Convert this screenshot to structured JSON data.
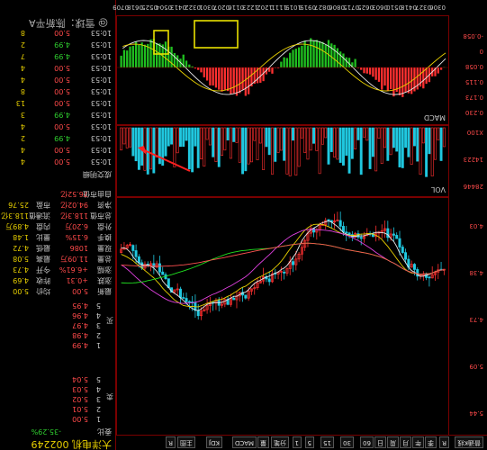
{
  "quote": {
    "title": "大洋电机 002249",
    "change_label": "委比",
    "change_value": "-35.29%",
    "sell_label": "卖",
    "buy_label": "买",
    "sell_levels": [
      {
        "n": "5",
        "price": "5.04",
        "vol": ""
      },
      {
        "n": "4",
        "price": "5.03",
        "vol": ""
      },
      {
        "n": "3",
        "price": "5.02",
        "vol": ""
      },
      {
        "n": "2",
        "price": "5.01",
        "vol": ""
      },
      {
        "n": "1",
        "price": "5.00",
        "vol": ""
      }
    ],
    "buy_levels": [
      {
        "n": "1",
        "price": "4.99",
        "vol": ""
      },
      {
        "n": "2",
        "price": "4.98",
        "vol": ""
      },
      {
        "n": "3",
        "price": "4.97",
        "vol": ""
      },
      {
        "n": "4",
        "price": "4.96",
        "vol": ""
      },
      {
        "n": "5",
        "price": "4.95",
        "vol": ""
      }
    ],
    "stats": [
      {
        "l1": "最新",
        "v1": "5.00",
        "l2": "均价",
        "v2": "5.00"
      },
      {
        "l1": "涨跌",
        "v1": "+0.31",
        "l2": "昨收",
        "v2": "4.69"
      },
      {
        "l1": "涨幅",
        "v1": "+6.61%",
        "l2": "今开",
        "v2": "4.73"
      },
      {
        "l1": "总量",
        "v1": "11.09万",
        "l2": "最高",
        "v2": "5.08"
      },
      {
        "l1": "现量",
        "v1": "1086",
        "l2": "最低",
        "v2": "4.72"
      },
      {
        "l1": "换手",
        "v1": "6.15%",
        "l2": "量比",
        "v2": "1.48"
      },
      {
        "l1": "外盘",
        "v1": "6.20万",
        "l2": "内盘",
        "v2": "4.89万"
      },
      {
        "l1": "总市值",
        "v1": "118.3亿",
        "l2": "流通值",
        "v2": "118.3亿"
      },
      {
        "l1": "净资",
        "v1": "94.02亿",
        "l2": "市盈",
        "v2": "25.76"
      },
      {
        "l1": "自由市值",
        "v1": "76.52亿",
        "l2": "",
        "v2": ""
      }
    ],
    "ticks_header": "成交明细",
    "ticks": [
      {
        "t": "10:53",
        "p": "5.00",
        "v": "4"
      },
      {
        "t": "10:53",
        "p": "5.00",
        "v": "4"
      },
      {
        "t": "10:53",
        "p": "4.99",
        "v": "2"
      },
      {
        "t": "10:53",
        "p": "5.00",
        "v": "4"
      },
      {
        "t": "10:53",
        "p": "4.99",
        "v": "3"
      },
      {
        "t": "10:53",
        "p": "5.00",
        "v": "13"
      },
      {
        "t": "10:53",
        "p": "5.00",
        "v": "8"
      },
      {
        "t": "10:53",
        "p": "5.00",
        "v": "4"
      },
      {
        "t": "10:53",
        "p": "5.00",
        "v": "4"
      },
      {
        "t": "10:53",
        "p": "4.99",
        "v": "7"
      },
      {
        "t": "10:53",
        "p": "4.99",
        "v": "2"
      },
      {
        "t": "10:53",
        "p": "5.00",
        "v": "8"
      }
    ],
    "watermark": "@ 雪球：陈新平A"
  },
  "toolbar": {
    "buttons": [
      "普通K线",
      "R",
      "季",
      "年",
      "月",
      "周",
      "日",
      "60",
      "30",
      "15",
      "5",
      "1",
      "分笔",
      "量",
      "MACD",
      "KDJ",
      "主图",
      "R"
    ]
  },
  "chart": {
    "price_ticks": [
      "5.44",
      "5.09",
      "4.73",
      "4.38",
      "4.03"
    ],
    "volume_ticks": [
      "28446",
      "14223",
      "X100"
    ],
    "volume_label": "VOL",
    "macd_label": "MACD",
    "macd_ticks": [
      "0.230",
      "0.173",
      "0.115",
      "0.058",
      "0",
      "-0.058"
    ],
    "date_ticks": [
      "0306",
      "0327",
      "0418",
      "0510",
      "0603",
      "0625",
      "0715",
      "0806",
      "0827",
      "0919",
      "1019",
      "1111",
      "1202",
      "1223",
      "0116",
      "0207",
      "0301",
      "0322",
      "0413",
      "0504",
      "0525",
      "0618",
      "0709"
    ]
  }
}
